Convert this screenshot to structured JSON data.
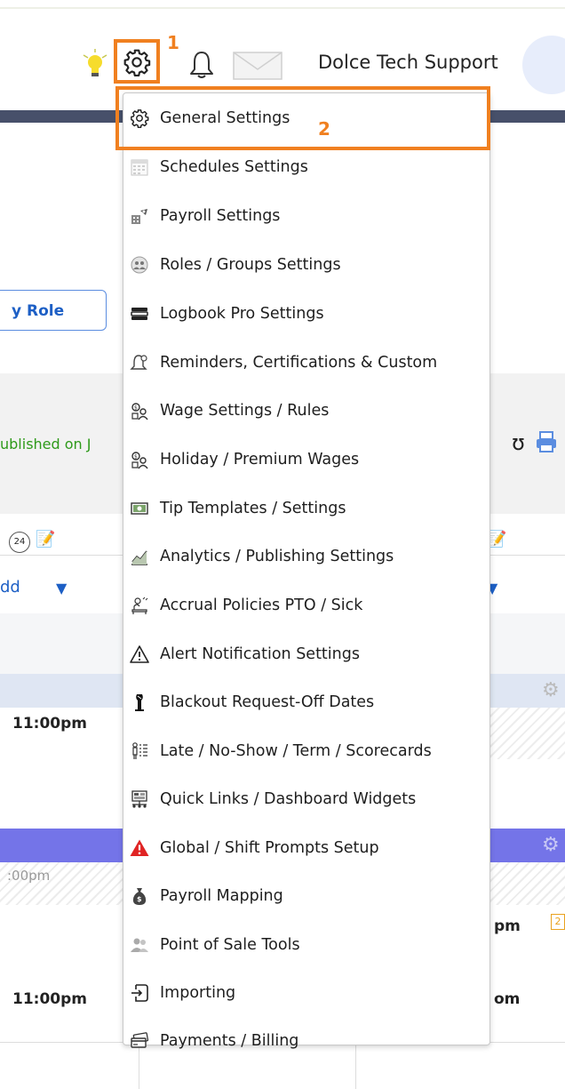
{
  "header": {
    "user_name": "Dolce Tech Support",
    "annotation_1": "1",
    "annotation_2": "2"
  },
  "background": {
    "role_button_label": "y Role",
    "published_text": "ublished on J",
    "hours_badge": "24",
    "add_text": "dd",
    "shift_time_1": "11:00pm",
    "shift_time_2": ":00pm",
    "shift_time_3": "pm",
    "badge_count": "2",
    "shift_time_4": "11:00pm",
    "shift_time_5": "om"
  },
  "menu": {
    "items": [
      {
        "label": "General Settings",
        "icon": "gear-icon"
      },
      {
        "label": "Schedules Settings",
        "icon": "calendar-icon"
      },
      {
        "label": "Payroll Settings",
        "icon": "payroll-icon"
      },
      {
        "label": "Roles / Groups Settings",
        "icon": "group-icon"
      },
      {
        "label": "Logbook Pro Settings",
        "icon": "logbook-icon"
      },
      {
        "label": "Reminders, Certifications & Custom",
        "icon": "reminder-bell-icon"
      },
      {
        "label": "Wage Settings / Rules",
        "icon": "wage-icon"
      },
      {
        "label": "Holiday / Premium Wages",
        "icon": "holiday-wage-icon"
      },
      {
        "label": "Tip Templates / Settings",
        "icon": "tip-icon"
      },
      {
        "label": "Analytics / Publishing Settings",
        "icon": "analytics-icon"
      },
      {
        "label": "Accrual Policies PTO / Sick",
        "icon": "accrual-icon"
      },
      {
        "label": "Alert Notification Settings",
        "icon": "alert-triangle-icon"
      },
      {
        "label": "Blackout Request-Off Dates",
        "icon": "blackout-icon"
      },
      {
        "label": "Late / No-Show / Term / Scorecards",
        "icon": "scorecard-icon"
      },
      {
        "label": "Quick Links / Dashboard Widgets",
        "icon": "dashboard-icon"
      },
      {
        "label": "Global / Shift Prompts Setup",
        "icon": "warning-red-icon"
      },
      {
        "label": "Payroll Mapping",
        "icon": "money-bag-icon"
      },
      {
        "label": "Point of Sale Tools",
        "icon": "people-icon"
      },
      {
        "label": "Importing",
        "icon": "import-icon"
      },
      {
        "label": "Payments / Billing",
        "icon": "cards-icon"
      }
    ]
  },
  "colors": {
    "annotation": "#f08020",
    "link_blue": "#1d5fc5",
    "published_green": "#2e9a1a",
    "shift_purple": "#7474e8"
  }
}
